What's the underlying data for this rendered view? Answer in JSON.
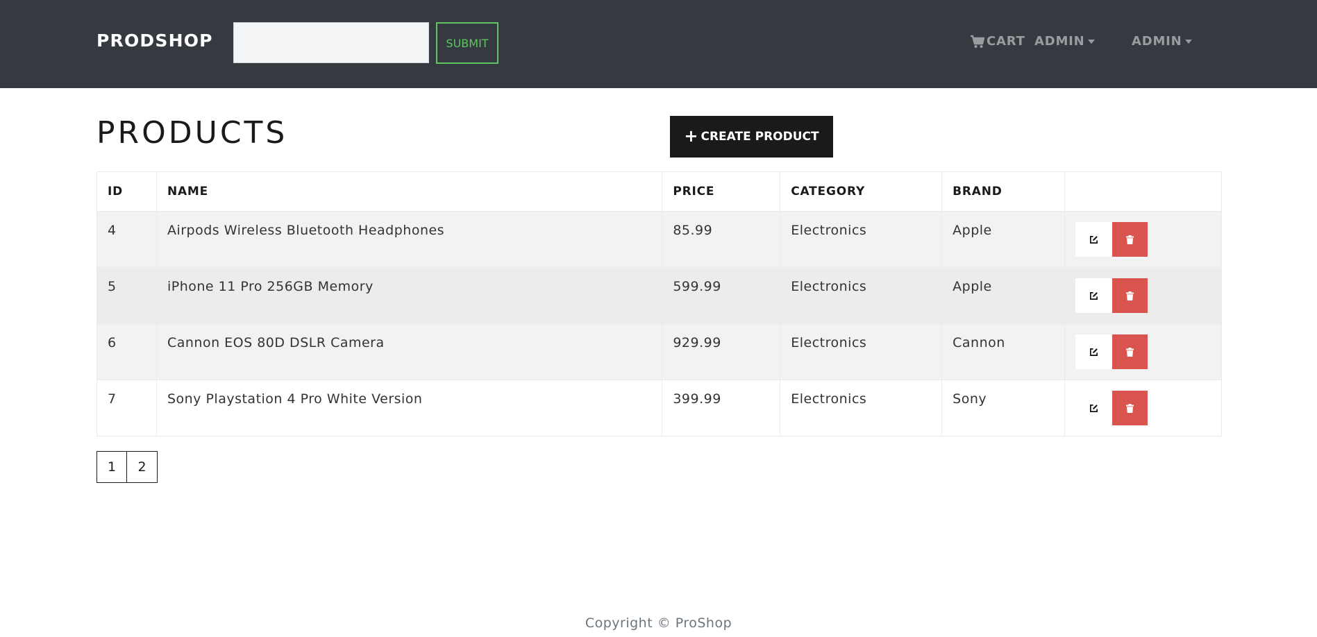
{
  "header": {
    "brand": "PRODSHOP",
    "search": {
      "value": "",
      "placeholder": ""
    },
    "submit_label": "SUBMIT",
    "cart_label": "CART",
    "admin_menu_1": "ADMIN",
    "admin_menu_2": "ADMIN",
    "bg_color": "#343a40"
  },
  "main": {
    "title": "PRODUCTS",
    "create_button_icon": "plus-icon",
    "create_button_label": "CREATE PRODUCT"
  },
  "table": {
    "headers": [
      "ID",
      "NAME",
      "PRICE",
      "CATEGORY",
      "BRAND",
      ""
    ],
    "rows": [
      {
        "id": "4",
        "name": "Airpods Wireless Bluetooth Headphones",
        "price": "85.99",
        "category": "Electronics",
        "brand": "Apple"
      },
      {
        "id": "5",
        "name": "iPhone 11 Pro 256GB Memory",
        "price": "599.99",
        "category": "Electronics",
        "brand": "Apple"
      },
      {
        "id": "6",
        "name": "Cannon EOS 80D DSLR Camera",
        "price": "929.99",
        "category": "Electronics",
        "brand": "Cannon"
      },
      {
        "id": "7",
        "name": "Sony Playstation 4 Pro White Version",
        "price": "399.99",
        "category": "Electronics",
        "brand": "Sony"
      }
    ],
    "row_actions": {
      "edit_icon": "edit-icon",
      "delete_icon": "trash-icon",
      "delete_color": "#d9534f"
    }
  },
  "pagination": {
    "pages": [
      "1",
      "2"
    ]
  },
  "footer": {
    "text": "Copyright © ProShop"
  }
}
